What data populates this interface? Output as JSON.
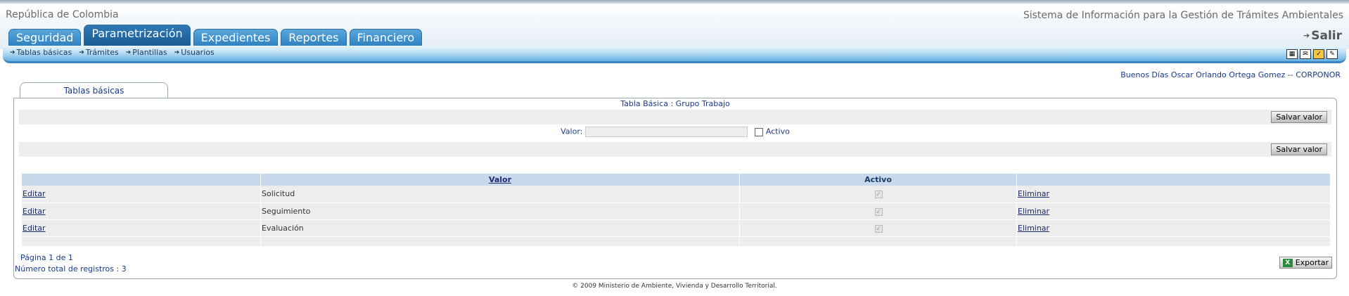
{
  "header": {
    "country": "República de Colombia",
    "system": "Sistema de Información para la Gestión de Trámites Ambientales",
    "logout": "Salir",
    "tabs": [
      "Seguridad",
      "Parametrización",
      "Expedientes",
      "Reportes",
      "Financiero"
    ],
    "active_tab": "Parametrización"
  },
  "subnav": [
    "Tablas básicas",
    "Trámites",
    "Plantillas",
    "Usuarios"
  ],
  "toolbar_icons": [
    "calendar-icon",
    "mail-icon",
    "checklist-icon",
    "document-edit-icon"
  ],
  "greeting": "Buenos Días Oscar Orlando Ortega Gomez -- CORPONOR",
  "content": {
    "tab": "Tablas básicas",
    "title": "Tabla Básica : Grupo Trabajo",
    "save_label": "Salvar valor",
    "value_label": "Valor:",
    "value": "",
    "active_label": "Activo",
    "table": {
      "headers": [
        "Valor",
        "Activo"
      ],
      "rows": [
        {
          "edit": "Editar",
          "valor": "Solicitud",
          "activo": true,
          "delete": "Eliminar"
        },
        {
          "edit": "Editar",
          "valor": "Seguimiento",
          "activo": true,
          "delete": "Eliminar"
        },
        {
          "edit": "Editar",
          "valor": "Evaluación",
          "activo": true,
          "delete": "Eliminar"
        }
      ]
    },
    "pagination": "Página 1 de 1",
    "total": "Número total de registros : 3",
    "export_label": "Exportar"
  },
  "footer": "© 2009 Ministerio de Ambiente, Vivienda y Desarrollo Territorial."
}
